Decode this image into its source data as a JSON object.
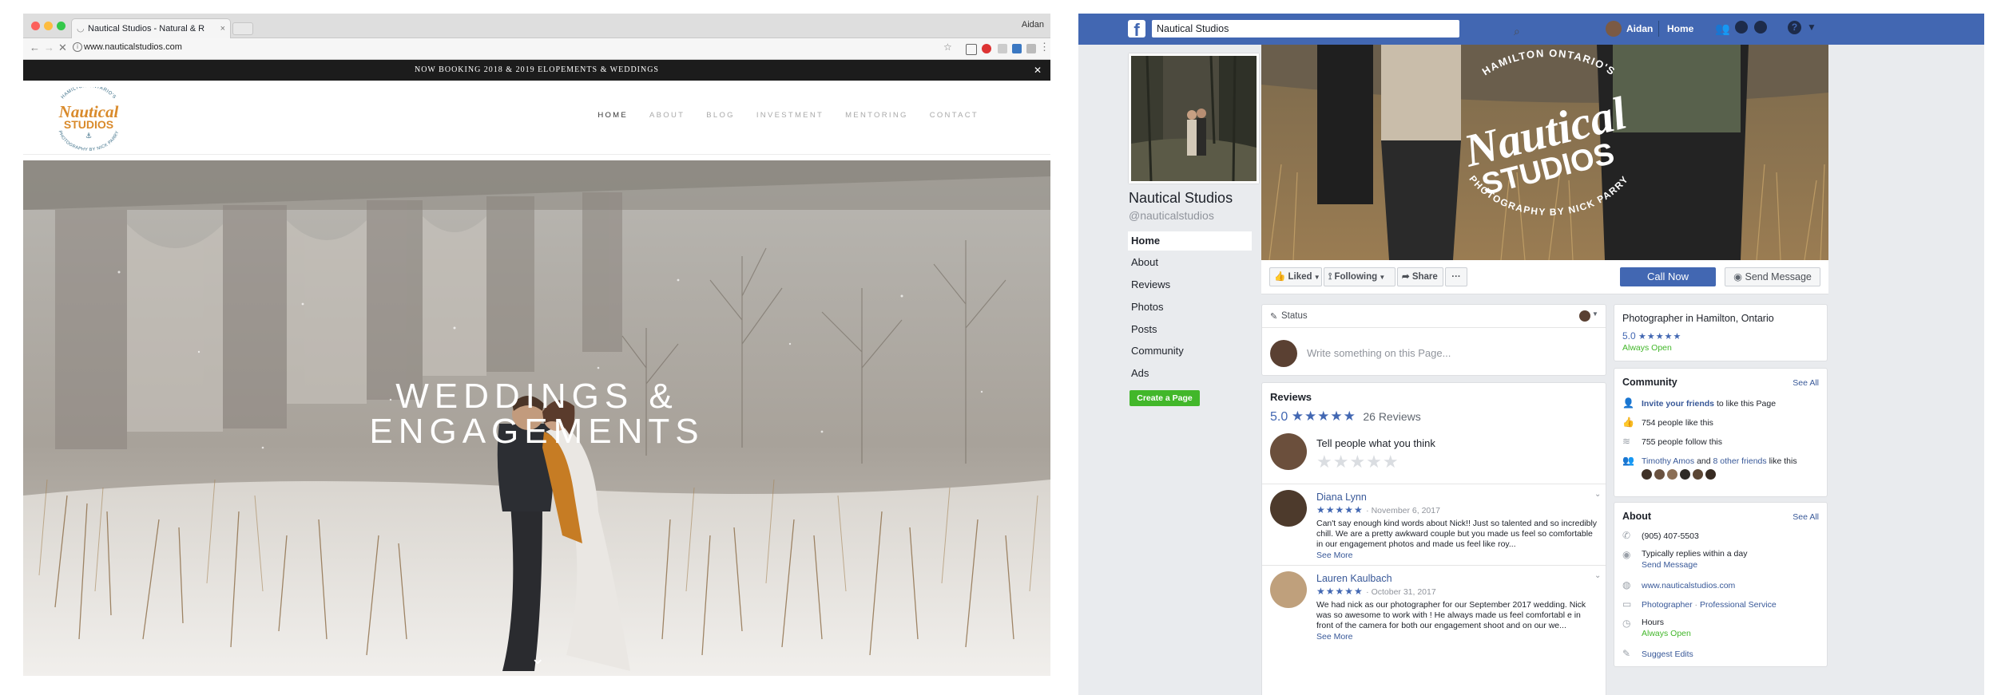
{
  "browser": {
    "tab_title": "Nautical Studios - Natural & R",
    "user": "Aidan",
    "url": "www.nauticalstudios.com"
  },
  "site": {
    "announcement": "NOW BOOKING 2018 & 2019 ELOPEMENTS & WEDDINGS",
    "logo": {
      "top_arc": "HAMILTON ONTARIO'S",
      "line1": "Nautical",
      "line2": "STUDIOS",
      "bottom_arc": "PHOTOGRAPHY BY NICK PARRY"
    },
    "nav": [
      "HOME",
      "ABOUT",
      "BLOG",
      "INVESTMENT",
      "MENTORING",
      "CONTACT"
    ],
    "hero_line1": "WEDDINGS &",
    "hero_line2": "ENGAGEMENTS"
  },
  "facebook": {
    "search_value": "Nautical Studios",
    "top_user": "Aidan",
    "top_home": "Home",
    "page_name": "Nautical Studios",
    "handle": "@nauticalstudios",
    "side_nav": [
      "Home",
      "About",
      "Reviews",
      "Photos",
      "Posts",
      "Community",
      "Ads"
    ],
    "create_page": "Create a Page",
    "cover_text": {
      "top_arc": "HAMILTON ONTARIO'S",
      "line1": "Nautical",
      "line2": "STUDIOS",
      "bottom_arc": "PHOTOGRAPHY BY NICK PARRY"
    },
    "actions": {
      "liked": "Liked",
      "following": "Following",
      "share": "Share",
      "more": "···",
      "call_now": "Call Now",
      "send_message": "Send Message"
    },
    "status": {
      "label": "Status",
      "placeholder": "Write something on this Page..."
    },
    "reviews": {
      "heading": "Reviews",
      "rating": "5.0",
      "count": "26 Reviews",
      "prompt": "Tell people what you think",
      "items": [
        {
          "name": "Diana Lynn",
          "date": "November 6, 2017",
          "text": "Can't say enough kind words about Nick!! Just so talented and so incredibly chill. We are a pretty awkward couple but you made us feel so comfortable in our engagement photos and made us feel like roy...",
          "more": "See More"
        },
        {
          "name": "Lauren Kaulbach",
          "date": "October 31, 2017",
          "text": "We had nick as our photographer for our September 2017 wedding. Nick was so awesome to work with ! He always made us feel comfortabl e in front of the camera for both our engagement shoot and on our we...",
          "more": "See More"
        }
      ]
    },
    "info": {
      "category": "Photographer in Hamilton, Ontario",
      "rating": "5.0",
      "open": "Always Open"
    },
    "community": {
      "heading": "Community",
      "see_all": "See All",
      "invite_link": "Invite your friends",
      "invite_rest": "to like this Page",
      "likes": "754 people like this",
      "follows": "755 people follow this",
      "friends_a": "Timothy Amos",
      "friends_and": "and",
      "friends_b": "8 other friends",
      "friends_rest": "like this"
    },
    "about": {
      "heading": "About",
      "see_all": "See All",
      "phone": "(905) 407-5503",
      "replies": "Typically replies within a day",
      "send_message": "Send Message",
      "website": "www.nauticalstudios.com",
      "category_a": "Photographer",
      "category_sep": " · ",
      "category_b": "Professional Service",
      "hours_label": "Hours",
      "hours_value": "Always Open",
      "suggest": "Suggest Edits"
    }
  },
  "colors": {
    "fb_blue": "#4267b2",
    "fb_link": "#385898",
    "fb_green": "#42b72a",
    "logo_orange": "#d98a2b",
    "logo_teal": "#3a6d86"
  }
}
